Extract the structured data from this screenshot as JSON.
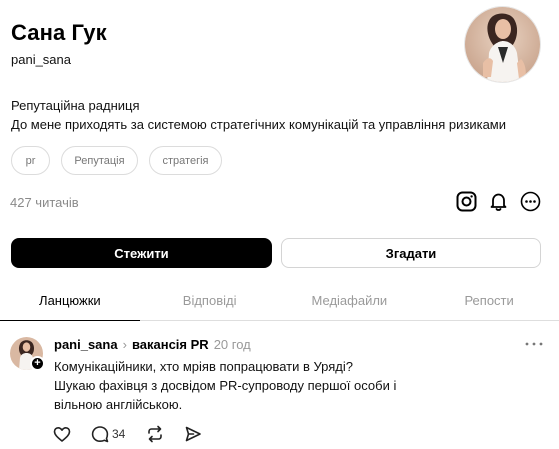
{
  "profile": {
    "name": "Сана Гук",
    "handle": "pani_sana",
    "bio_line1": "Репутаційна радниця",
    "bio_line2": "До мене приходять за системою стратегічних комунікацій та управління ризиками",
    "tags": [
      "pr",
      "Репутація",
      "стратегія"
    ],
    "followers": "427 читачів",
    "follow_label": "Стежити",
    "mention_label": "Згадати"
  },
  "icons": [
    "instagram-icon",
    "bell-icon",
    "more-icon"
  ],
  "tabs": [
    "Ланцюжки",
    "Відповіді",
    "Медіафайли",
    "Репости"
  ],
  "post": {
    "author": "pani_sana",
    "topic": "вакансія PR",
    "time": "20 год",
    "line1": "Комунікаційники, хто мріяв попрацювати в Уряді?",
    "line2": "Шукаю фахівця з досвідом PR-супроводу першої особи і",
    "line3": "вільною англійською.",
    "replies": "34"
  }
}
